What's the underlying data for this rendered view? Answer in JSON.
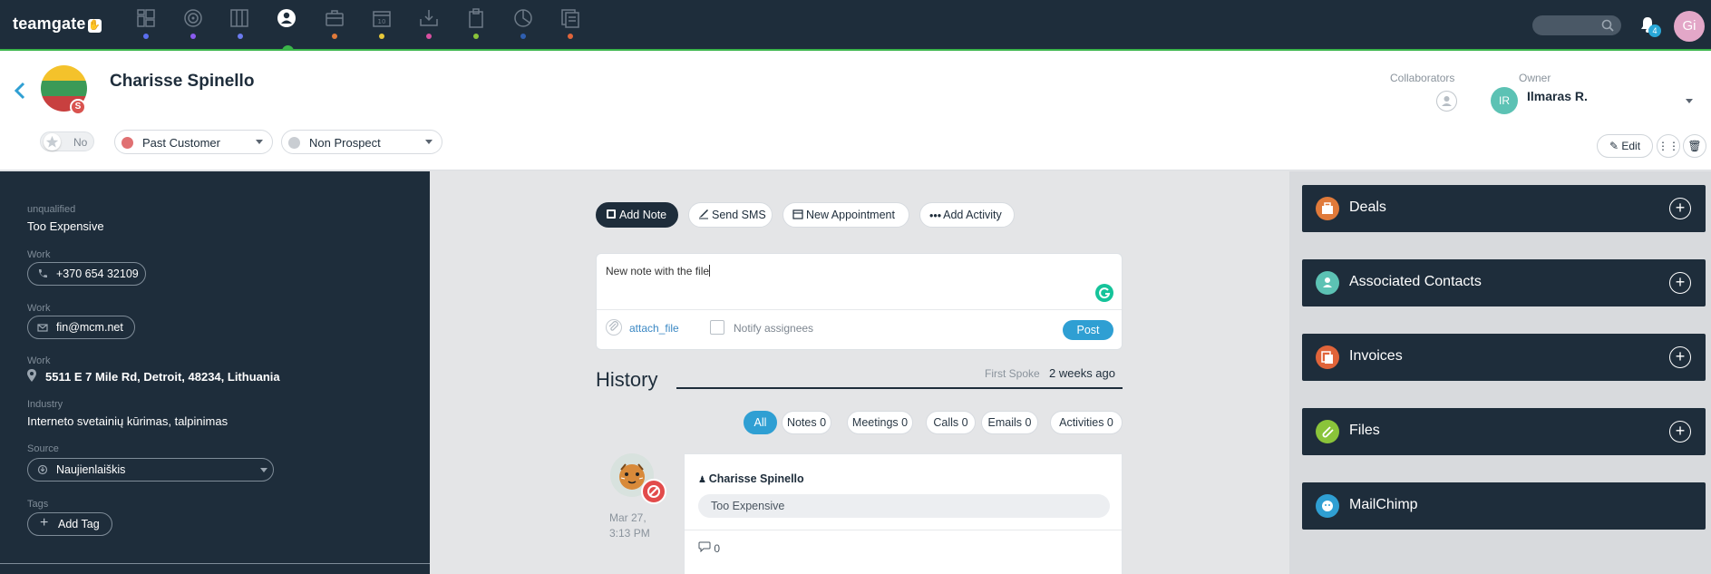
{
  "app": {
    "logo": "teamgate",
    "notifications_count": "4",
    "user_initials": "Gi"
  },
  "nav_icons": [
    "dashboard-icon",
    "target-icon",
    "pipeline-icon",
    "contacts-icon",
    "deals-icon",
    "calendar-icon",
    "inbox-icon",
    "documents-icon",
    "reports-icon",
    "invoices-icon"
  ],
  "nav_dot_colors": [
    "#5b6ff0",
    "#8a5cf0",
    "#6b7bf0",
    "#3bb54a",
    "#e07a3a",
    "#e8c93a",
    "#d94fa0",
    "#8ac43a",
    "#2f5fb0",
    "#e0643a"
  ],
  "contact": {
    "name": "Charisse Spinello",
    "flag_badge": "S",
    "star_label": "No",
    "status": "Past Customer",
    "prospect": "Non Prospect",
    "collaborators_label": "Collaborators",
    "owner_label": "Owner",
    "owner_initials": "IR",
    "owner_name": "Ilmaras R.",
    "edit_label": "Edit"
  },
  "details": {
    "unqualified_label": "unqualified",
    "unqualified_value": "Too Expensive",
    "phone_label": "Work",
    "phone": "+370 654 32109",
    "email_label": "Work",
    "email": "fin@mcm.net",
    "address_label": "Work",
    "address": "5511 E 7 Mile Rd, Detroit, 48234, Lithuania",
    "industry_label": "Industry",
    "industry": "Interneto svetainių kūrimas, talpinimas",
    "source_label": "Source",
    "source": "Naujienlaiškis",
    "tags_label": "Tags",
    "add_tag": "Add Tag"
  },
  "actions": {
    "add_note": "Add Note",
    "send_sms": "Send SMS",
    "new_appointment": "New Appointment",
    "add_activity": "Add Activity"
  },
  "note": {
    "text": "New note with the file",
    "attach": "attach_file",
    "notify": "Notify assignees",
    "post": "Post"
  },
  "history": {
    "title": "History",
    "first_spoke_label": "First Spoke",
    "first_spoke_value": "2 weeks ago",
    "filters": [
      "All",
      "Notes 0",
      "Meetings 0",
      "Calls 0",
      "Emails 0",
      "Activities 0"
    ],
    "entry": {
      "date_line1": "Mar 27,",
      "date_line2": "3:13 PM",
      "author": "Charisse Spinello",
      "reason": "Too Expensive",
      "comments": "0"
    }
  },
  "widgets": [
    {
      "title": "Deals",
      "color": "#e07a3a"
    },
    {
      "title": "Associated Contacts",
      "color": "#5cc2b4"
    },
    {
      "title": "Invoices",
      "color": "#e0643a"
    },
    {
      "title": "Files",
      "color": "#8ac43a"
    },
    {
      "title": "MailChimp",
      "color": "#2f9fd3"
    }
  ]
}
